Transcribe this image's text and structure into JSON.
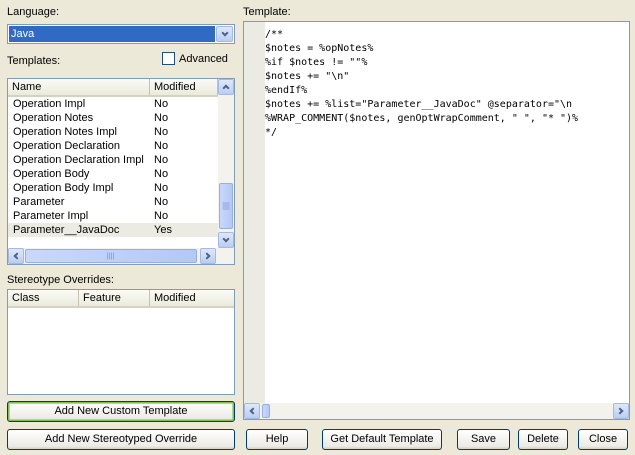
{
  "language": {
    "label": "Language:",
    "selected": "Java"
  },
  "templates": {
    "label": "Templates:",
    "advanced_label": "Advanced",
    "columns": [
      "Name",
      "Modified"
    ],
    "rows": [
      {
        "name": "Operation Impl",
        "modified": "No"
      },
      {
        "name": "Operation Notes",
        "modified": "No"
      },
      {
        "name": "Operation Notes Impl",
        "modified": "No"
      },
      {
        "name": "Operation Declaration",
        "modified": "No"
      },
      {
        "name": "Operation Declaration Impl",
        "modified": "No"
      },
      {
        "name": "Operation Body",
        "modified": "No"
      },
      {
        "name": "Operation Body Impl",
        "modified": "No"
      },
      {
        "name": "Parameter",
        "modified": "No"
      },
      {
        "name": "Parameter Impl",
        "modified": "No"
      },
      {
        "name": "Parameter__JavaDoc",
        "modified": "Yes"
      }
    ]
  },
  "stereotype_overrides": {
    "label": "Stereotype Overrides:",
    "columns": [
      "Class",
      "Feature",
      "Modified"
    ]
  },
  "template_editor": {
    "label": "Template:",
    "lines": [
      "/**",
      "$notes = %opNotes%",
      "%if $notes != \"\"%",
      "$notes += \"\\n\"",
      "%endIf%",
      "$notes += %list=\"Parameter__JavaDoc\" @separator=\"\\n",
      "%WRAP_COMMENT($notes, genOptWrapComment, \" \", \"* \")%",
      "*/"
    ]
  },
  "buttons": {
    "add_custom": "Add New Custom Template",
    "add_stereotyped": "Add New Stereotyped Override",
    "help": "Help",
    "get_default": "Get Default Template",
    "save": "Save",
    "delete": "Delete",
    "close": "Close"
  },
  "icons": {
    "combo_arrow": "chevron-down-icon",
    "scroll_up": "chevron-up-icon",
    "scroll_down": "chevron-down-icon",
    "scroll_left": "chevron-left-icon",
    "scroll_right": "chevron-right-icon"
  },
  "colors": {
    "selection": "#316ac5",
    "window_bg": "#ece9d8",
    "border": "#7f9db9"
  }
}
